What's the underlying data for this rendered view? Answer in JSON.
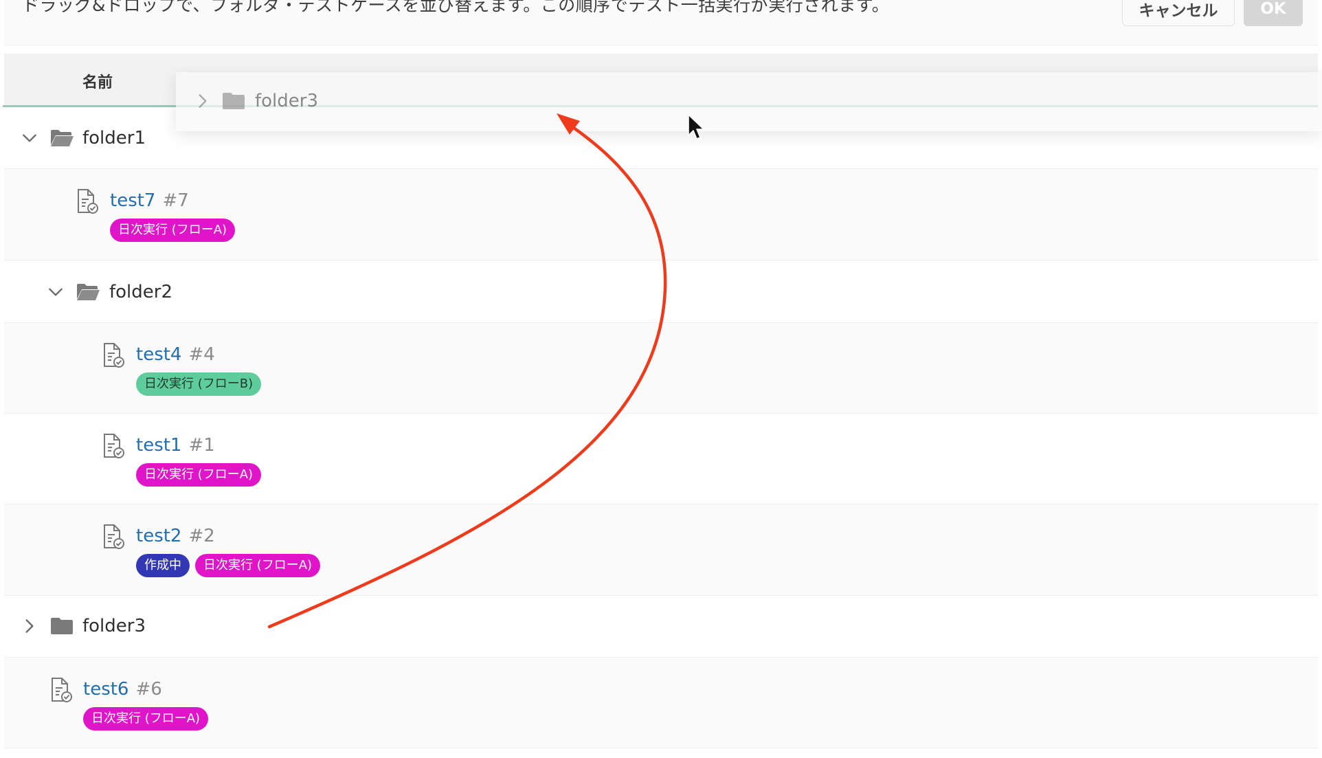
{
  "header": {
    "instruction": "ドラッグ&ドロップで、フォルダ・テストケースを並び替えます。この順序でテスト一括実行が実行されます。",
    "cancel_label": "キャンセル",
    "ok_label": "OK"
  },
  "table": {
    "column_name": "名前"
  },
  "drag_ghost": {
    "label": "folder3"
  },
  "rows": [
    {
      "kind": "folder",
      "name": "folder1",
      "expanded": true,
      "level": 0
    },
    {
      "kind": "test",
      "name": "test7",
      "id": "#7",
      "level": 1,
      "tags": [
        "日次実行 (フローA)"
      ]
    },
    {
      "kind": "folder",
      "name": "folder2",
      "expanded": true,
      "level": 1
    },
    {
      "kind": "test",
      "name": "test4",
      "id": "#4",
      "level": 2,
      "tags": [
        "日次実行 (フローB)"
      ]
    },
    {
      "kind": "test",
      "name": "test1",
      "id": "#1",
      "level": 2,
      "tags": [
        "日次実行 (フローA)"
      ]
    },
    {
      "kind": "test",
      "name": "test2",
      "id": "#2",
      "level": 2,
      "tags": [
        "作成中",
        "日次実行 (フローA)"
      ]
    },
    {
      "kind": "folder",
      "name": "folder3",
      "expanded": false,
      "level": 0
    },
    {
      "kind": "test",
      "name": "test6",
      "id": "#6",
      "level": 0,
      "tags": [
        "日次実行 (フローA)"
      ]
    }
  ],
  "colors": {
    "tag_flow_a": "#e014c8",
    "tag_flow_b": "#5fcc9c",
    "tag_draft": "#3238b4",
    "link": "#1f6fb0",
    "drop_indicator": "#9ec6b8",
    "annotation_arrow": "#f03a1c"
  },
  "icons": {
    "expanded": "chevron-down-icon",
    "collapsed": "chevron-right-icon",
    "folder_open": "folder-open-icon",
    "folder_closed": "folder-icon",
    "test_case": "test-case-icon",
    "cursor": "mouse-cursor-icon",
    "annotation": "annotation-arrow"
  }
}
